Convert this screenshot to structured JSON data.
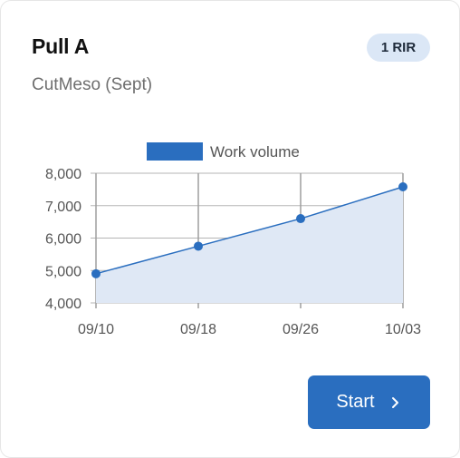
{
  "card": {
    "title": "Pull A",
    "subtitle": "CutMeso (Sept)",
    "badge": "1 RIR"
  },
  "chart_data": {
    "type": "area",
    "x": [
      "09/10",
      "09/18",
      "09/26",
      "10/03"
    ],
    "series": [
      {
        "name": "Work volume",
        "values": [
          4900,
          5750,
          6600,
          7580
        ]
      }
    ],
    "y_ticks": [
      "8,000",
      "7,000",
      "6,000",
      "5,000",
      "4,000"
    ],
    "ylim": [
      4000,
      8000
    ],
    "legend_position": "top",
    "grid": true,
    "line_color": "#2a6ebf",
    "fill_color": "#dfe8f5"
  },
  "actions": {
    "start_label": "Start",
    "start_icon": "chevron-right-icon"
  },
  "colors": {
    "accent": "#2a6ebf",
    "badge_bg": "#dbe7f6"
  }
}
